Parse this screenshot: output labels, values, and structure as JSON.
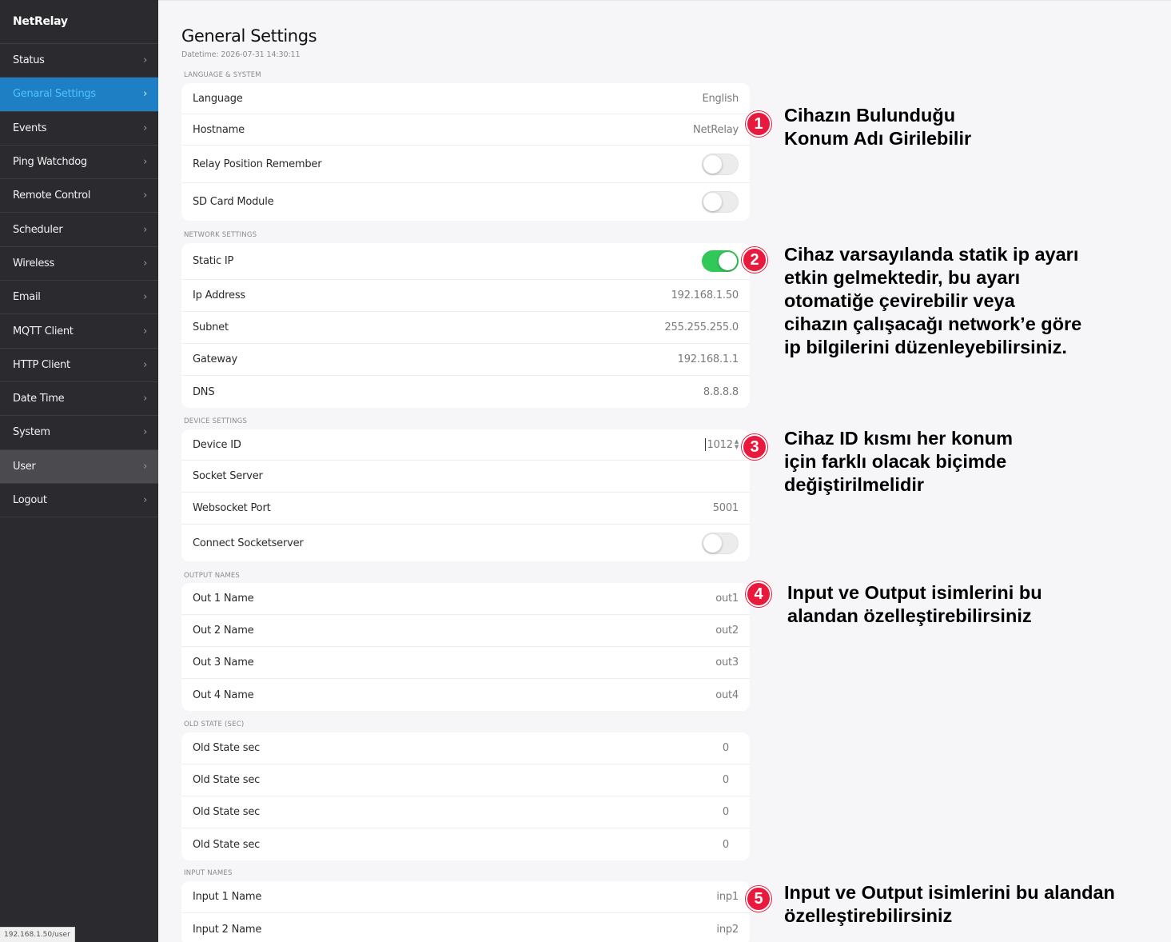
{
  "sidebar": {
    "brand": "NetRelay",
    "chevron": "›",
    "items": [
      {
        "label": "Status"
      },
      {
        "label": "Genaral Settings"
      },
      {
        "label": "Events"
      },
      {
        "label": "Ping Watchdog"
      },
      {
        "label": "Remote Control"
      },
      {
        "label": "Scheduler"
      },
      {
        "label": "Wireless"
      },
      {
        "label": "Email"
      },
      {
        "label": "MQTT Client"
      },
      {
        "label": "HTTP Client"
      },
      {
        "label": "Date Time"
      },
      {
        "label": "System"
      },
      {
        "label": "User"
      },
      {
        "label": "Logout"
      }
    ],
    "status_url": "192.168.1.50/user"
  },
  "page": {
    "title": "General Settings",
    "datetime": "Datetime: 2026-07-31 14:30:11"
  },
  "sections": {
    "language_system": {
      "label": "LANGUAGE & SYSTEM",
      "language": {
        "label": "Language",
        "value": "English"
      },
      "hostname": {
        "label": "Hostname",
        "value": "NetRelay"
      },
      "relay_position": {
        "label": "Relay Position Remember",
        "on": false
      },
      "sd_card": {
        "label": "SD Card Module",
        "on": false
      }
    },
    "network": {
      "label": "NETWORK SETTINGS",
      "static_ip": {
        "label": "Static IP",
        "on": true
      },
      "ip": {
        "label": "Ip Address",
        "value": "192.168.1.50"
      },
      "subnet": {
        "label": "Subnet",
        "value": "255.255.255.0"
      },
      "gateway": {
        "label": "Gateway",
        "value": "192.168.1.1"
      },
      "dns": {
        "label": "DNS",
        "value": "8.8.8.8"
      }
    },
    "device": {
      "label": "DEVICE SETTINGS",
      "device_id": {
        "label": "Device ID",
        "value": "1012"
      },
      "socket_server": {
        "label": "Socket Server"
      },
      "ws_port": {
        "label": "Websocket Port",
        "value": "5001"
      },
      "connect": {
        "label": "Connect Socketserver",
        "on": false
      }
    },
    "outputs": {
      "label": "OUTPUT NAMES",
      "rows": [
        {
          "label": "Out 1 Name",
          "value": "out1"
        },
        {
          "label": "Out 2 Name",
          "value": "out2"
        },
        {
          "label": "Out 3 Name",
          "value": "out3"
        },
        {
          "label": "Out 4 Name",
          "value": "out4"
        }
      ]
    },
    "old_state": {
      "label": "OLD STATE (SEC)",
      "rows": [
        {
          "label": "Old State sec",
          "value": "0"
        },
        {
          "label": "Old State sec",
          "value": "0"
        },
        {
          "label": "Old State sec",
          "value": "0"
        },
        {
          "label": "Old State sec",
          "value": "0"
        }
      ]
    },
    "inputs": {
      "label": "INPUT NAMES",
      "rows": [
        {
          "label": "Input 1 Name",
          "value": "inp1"
        },
        {
          "label": "Input 2 Name",
          "value": "inp2"
        }
      ]
    }
  },
  "annotations": [
    {
      "num": "1",
      "text": "Cihazın Bulunduğu\nKonum Adı Girilebilir"
    },
    {
      "num": "2",
      "text": "Cihaz varsayılanda statik ip ayarı\netkin gelmektedir, bu ayarı\notomatiğe çevirebilir veya\ncihazın çalışacağı network’e göre\nip bilgilerini düzenleyebilirsiniz."
    },
    {
      "num": "3",
      "text": "Cihaz ID kısmı her konum\niçin farklı olacak biçimde\ndeğiştirilmelidir"
    },
    {
      "num": "4",
      "text": "Input ve Output isimlerini bu\nalandan özelleştirebilirsiniz"
    },
    {
      "num": "5",
      "text": "Input ve Output isimlerini bu alandan\nözelleştirebilirsiniz"
    }
  ],
  "colors": {
    "sidebar_bg": "#2b2b2f",
    "active_nav": "#1f7fc4",
    "toggle_on": "#30c859",
    "badge": "#e8193c"
  }
}
